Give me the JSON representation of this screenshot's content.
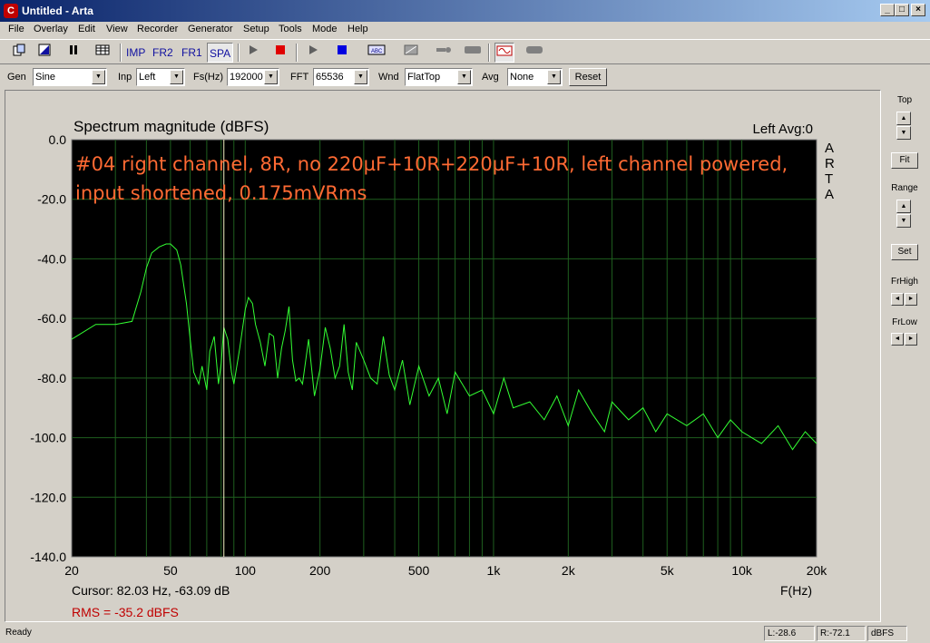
{
  "window": {
    "title": "Untitled - Arta",
    "app_icon": "C",
    "buttons": {
      "minimize": "_",
      "maximize": "□",
      "close": "×"
    }
  },
  "menu": [
    "File",
    "Overlay",
    "Edit",
    "View",
    "Recorder",
    "Generator",
    "Setup",
    "Tools",
    "Mode",
    "Help"
  ],
  "toolbar": {
    "imp": "IMP",
    "fr2": "FR2",
    "fr1": "FR1",
    "spa": "SPA",
    "icons": [
      "new-document-icon",
      "open-icon",
      "pause-icon",
      "grid-icon",
      "play-icon",
      "stop-icon",
      "play-icon",
      "stop-icon",
      "abc-icon",
      "overlay-icon",
      "probe-icon",
      "device-icon",
      "sine-icon",
      "device-icon"
    ]
  },
  "controls": {
    "gen_label": "Gen",
    "gen_value": "Sine",
    "inp_label": "Inp",
    "inp_value": "Left",
    "fs_label": "Fs(Hz)",
    "fs_value": "192000",
    "fft_label": "FFT",
    "fft_value": "65536",
    "wnd_label": "Wnd",
    "wnd_value": "FlatTop",
    "avg_label": "Avg",
    "avg_value": "None",
    "reset_label": "Reset"
  },
  "sidebar": {
    "top_label": "Top",
    "fit_label": "Fit",
    "range_label": "Range",
    "set_label": "Set",
    "frhigh_label": "FrHigh",
    "frlow_label": "FrLow"
  },
  "chart_data": {
    "type": "line",
    "title": "Spectrum magnitude (dBFS)",
    "channel_info": "Left  Avg:0",
    "watermark": [
      "A",
      "R",
      "T",
      "A"
    ],
    "annotation_line1": "#04 right channel, 8R, no 220µF+10R+220µF+10R, left channel powered,",
    "annotation_line2": "input shortened, 0.175mVRms",
    "xlabel": "F(Hz)",
    "xscale": "log",
    "xlim": [
      20,
      20000
    ],
    "ylim": [
      -140,
      0
    ],
    "x_ticks": [
      {
        "v": 20,
        "label": "20"
      },
      {
        "v": 50,
        "label": "50"
      },
      {
        "v": 100,
        "label": "100"
      },
      {
        "v": 200,
        "label": "200"
      },
      {
        "v": 500,
        "label": "500"
      },
      {
        "v": 1000,
        "label": "1k"
      },
      {
        "v": 2000,
        "label": "2k"
      },
      {
        "v": 5000,
        "label": "5k"
      },
      {
        "v": 10000,
        "label": "10k"
      },
      {
        "v": 20000,
        "label": "20k"
      }
    ],
    "y_ticks": [
      {
        "v": 0,
        "label": "0.0"
      },
      {
        "v": -20,
        "label": "-20.0"
      },
      {
        "v": -40,
        "label": "-40.0"
      },
      {
        "v": -60,
        "label": "-60.0"
      },
      {
        "v": -80,
        "label": "-80.0"
      },
      {
        "v": -100,
        "label": "-100.0"
      },
      {
        "v": -120,
        "label": "-120.0"
      },
      {
        "v": -140,
        "label": "-140.0"
      }
    ],
    "grid": true,
    "cursor_x": 82.03,
    "cursor_text": "Cursor: 82.03 Hz, -63.09 dB",
    "rms_text": "RMS =  -35.2 dBFS",
    "colors": {
      "background": "#000000",
      "trace": "#33ff33",
      "grid": "#1f5f1f",
      "annotation": "#ff6a33",
      "cursor": "#f0f0c0",
      "rms": "#c00000"
    },
    "series": [
      {
        "x": [
          20,
          25,
          30,
          35,
          38,
          40,
          42,
          45,
          48,
          50,
          53,
          55,
          58,
          60,
          62,
          65,
          67,
          70,
          72,
          75,
          78,
          80,
          82,
          85,
          88,
          90,
          95,
          100,
          103,
          107,
          110,
          115,
          120,
          125,
          130,
          135,
          140,
          145,
          150,
          155,
          160,
          165,
          170,
          180,
          190,
          200,
          210,
          220,
          230,
          240,
          250,
          260,
          270,
          280,
          300,
          320,
          340,
          360,
          380,
          400,
          430,
          460,
          500,
          550,
          600,
          650,
          700,
          800,
          900,
          1000,
          1100,
          1200,
          1400,
          1600,
          1800,
          2000,
          2200,
          2500,
          2800,
          3000,
          3500,
          4000,
          4500,
          5000,
          6000,
          7000,
          8000,
          9000,
          10000,
          12000,
          14000,
          16000,
          18000,
          20000
        ],
        "y": [
          -67,
          -62,
          -62,
          -61,
          -51,
          -43,
          -38,
          -36,
          -35,
          -35,
          -37,
          -42,
          -55,
          -67,
          -78,
          -82,
          -76,
          -84,
          -71,
          -66,
          -82,
          -75,
          -63,
          -67,
          -78,
          -82,
          -70,
          -57,
          -53,
          -55,
          -62,
          -68,
          -76,
          -65,
          -66,
          -80,
          -70,
          -64,
          -56,
          -74,
          -81,
          -80,
          -82,
          -67,
          -86,
          -77,
          -63,
          -70,
          -80,
          -76,
          -62,
          -78,
          -84,
          -68,
          -74,
          -80,
          -82,
          -66,
          -79,
          -84,
          -74,
          -89,
          -76,
          -86,
          -80,
          -92,
          -78,
          -86,
          -84,
          -92,
          -80,
          -90,
          -88,
          -94,
          -86,
          -96,
          -84,
          -92,
          -98,
          -88,
          -94,
          -90,
          -98,
          -92,
          -96,
          -92,
          -100,
          -94,
          -98,
          -102,
          -96,
          -104,
          -98,
          -102
        ]
      }
    ]
  },
  "status": {
    "ready": "Ready",
    "l_value": "L:-28.6",
    "r_value": "R:-72.1",
    "unit": "dBFS"
  }
}
